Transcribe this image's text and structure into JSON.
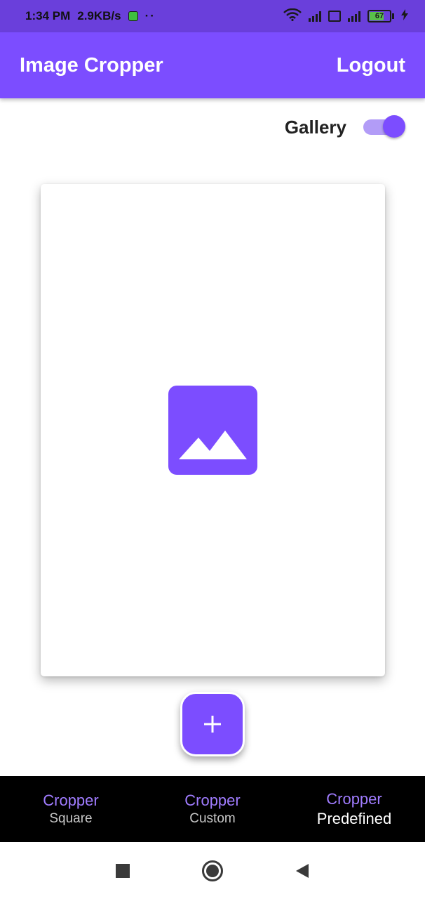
{
  "status_bar": {
    "time": "1:34 PM",
    "net_speed": "2.9KB/s",
    "dots": "··",
    "battery_level": "67",
    "icons": [
      "app-notification-icon",
      "wifi-icon",
      "signal-icon",
      "volte-icon",
      "4g-signal-icon",
      "battery-icon",
      "charging-icon"
    ]
  },
  "app_bar": {
    "title": "Image Cropper",
    "logout_label": "Logout"
  },
  "gallery_toggle": {
    "label": "Gallery",
    "enabled": true
  },
  "image_card": {
    "placeholder_icon": "image-placeholder-icon"
  },
  "fab": {
    "label": "+",
    "icon": "add-icon"
  },
  "bottom_nav": {
    "items": [
      {
        "title": "Cropper",
        "subtitle": "Square",
        "active": false
      },
      {
        "title": "Cropper",
        "subtitle": "Custom",
        "active": false
      },
      {
        "title": "Cropper",
        "subtitle": "Predefined",
        "active": true
      }
    ]
  },
  "system_nav": {
    "buttons": [
      "recents-icon",
      "home-icon",
      "back-icon"
    ]
  },
  "colors": {
    "primary": "#7c4dff",
    "status_bar": "#6a3fdb",
    "toggle_track": "#b29cf7",
    "nav_background": "#000000",
    "nav_title": "#a07cff"
  }
}
